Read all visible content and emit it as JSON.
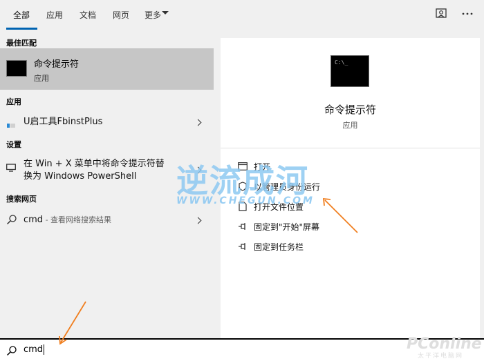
{
  "tabs": [
    {
      "label": "全部"
    },
    {
      "label": "应用"
    },
    {
      "label": "文档"
    },
    {
      "label": "网页"
    },
    {
      "label": "更多"
    }
  ],
  "left": {
    "best_match_header": "最佳匹配",
    "best_match": {
      "title": "命令提示符",
      "subtitle": "应用",
      "icon": "command-prompt-icon"
    },
    "apps_header": "应用",
    "apps": [
      {
        "label": "U启工具FbinstPlus",
        "icon": "app-icon"
      }
    ],
    "settings_header": "设置",
    "settings": [
      {
        "line1": "在 Win + X 菜单中将命令提示符替",
        "line2": "换为 Windows PowerShell",
        "icon": "monitor-icon"
      }
    ],
    "web_header": "搜索网页",
    "web": [
      {
        "label": "cmd",
        "suffix": " - 查看网络搜索结果",
        "icon": "search-icon"
      }
    ]
  },
  "right": {
    "app_title": "命令提示符",
    "app_subtitle": "应用",
    "actions": [
      {
        "label": "打开",
        "icon": "open-icon"
      },
      {
        "label": "以管理员身份运行",
        "icon": "shield-icon"
      },
      {
        "label": "打开文件位置",
        "icon": "file-location-icon"
      },
      {
        "label": "固定到\"开始\"屏幕",
        "icon": "pin-icon"
      },
      {
        "label": "固定到任务栏",
        "icon": "pin-icon"
      }
    ]
  },
  "search": {
    "value": "cmd"
  },
  "watermark": {
    "cn": "逆流成河",
    "url": "WWW.CHEGUN.COM",
    "logo": "PConline",
    "logo_sub": "太平洋电脑网"
  },
  "colors": {
    "accent": "#0063b1",
    "selected_bg": "#c6c6c6",
    "arrow": "#f07e1e",
    "watermark": "#8ec9f2"
  }
}
